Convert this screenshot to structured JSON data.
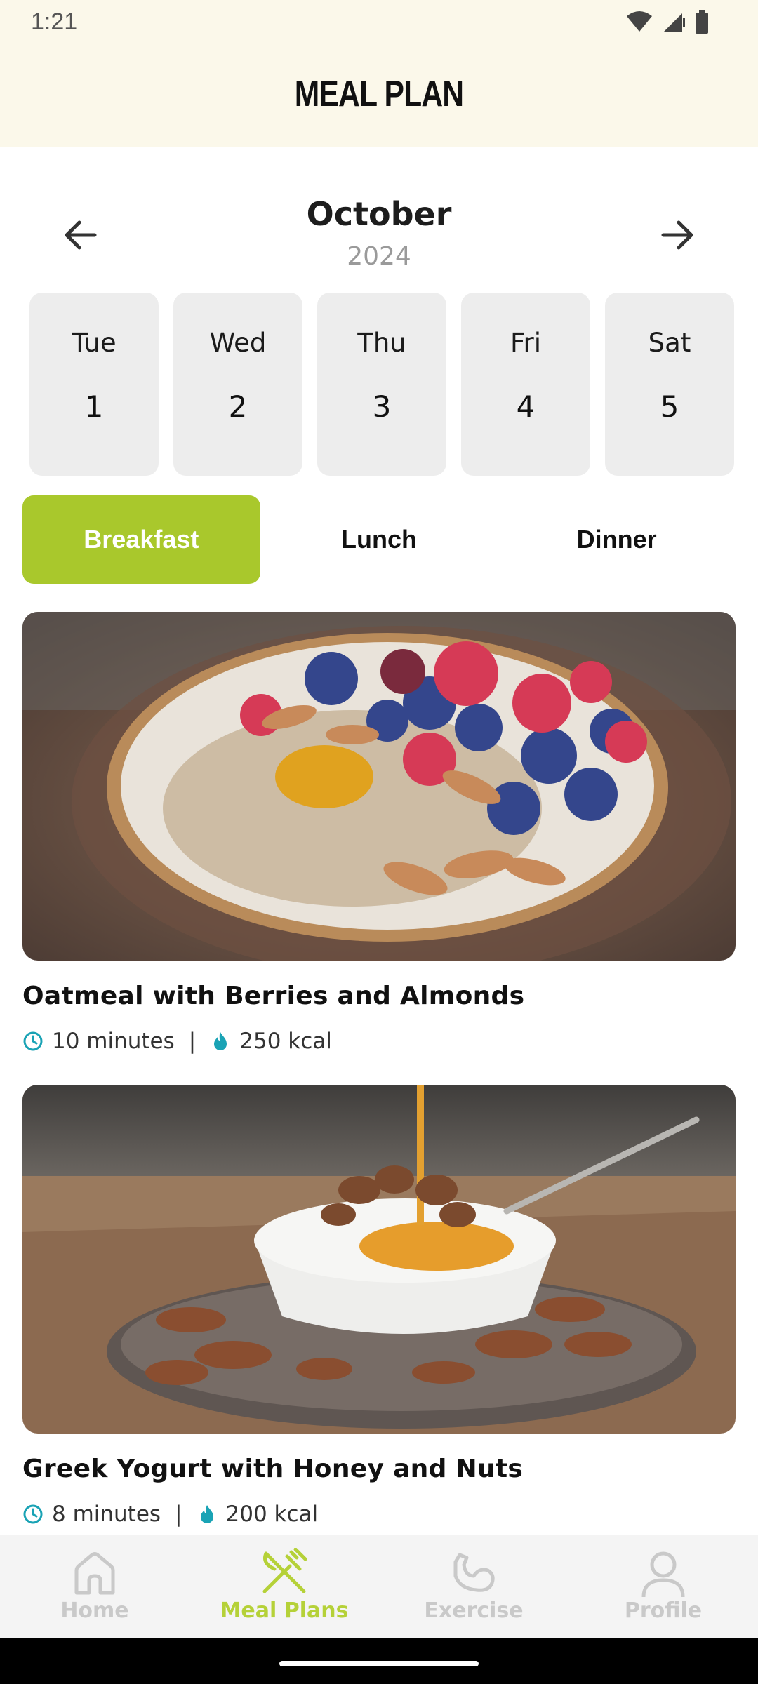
{
  "status_bar": {
    "time": "1:21"
  },
  "header": {
    "title": "MEAL PLAN"
  },
  "calendar": {
    "month": "October",
    "year": "2024",
    "days": [
      {
        "name": "Tue",
        "number": "1"
      },
      {
        "name": "Wed",
        "number": "2"
      },
      {
        "name": "Thu",
        "number": "3"
      },
      {
        "name": "Fri",
        "number": "4"
      },
      {
        "name": "Sat",
        "number": "5"
      }
    ]
  },
  "tabs": [
    {
      "label": "Breakfast",
      "active": true
    },
    {
      "label": "Lunch",
      "active": false
    },
    {
      "label": "Dinner",
      "active": false
    }
  ],
  "meals": [
    {
      "title": "Oatmeal with Berries and Almonds",
      "time": "10 minutes",
      "separator": "|",
      "calories": "250 kcal"
    },
    {
      "title": "Greek Yogurt with Honey and Nuts",
      "time": "8 minutes",
      "separator": "|",
      "calories": "200 kcal"
    }
  ],
  "bottom_nav": [
    {
      "label": "Home",
      "icon": "home-icon",
      "active": false
    },
    {
      "label": "Meal Plans",
      "icon": "fork-knife-icon",
      "active": true
    },
    {
      "label": "Exercise",
      "icon": "flexed-arm-icon",
      "active": false
    },
    {
      "label": "Profile",
      "icon": "person-icon",
      "active": false
    }
  ],
  "colors": {
    "accent": "#a9c82c",
    "header_bg": "#fbf8ea",
    "meta_icon": "#1aa3b5",
    "day_chip_bg": "#ededed"
  }
}
